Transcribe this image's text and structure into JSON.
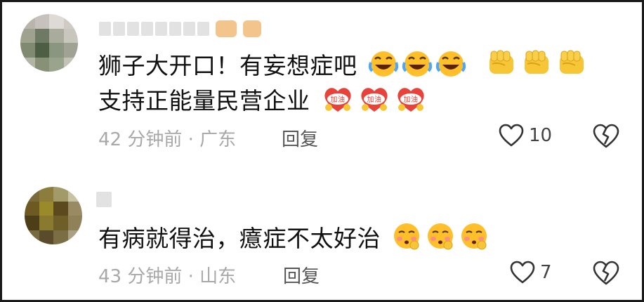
{
  "comments": [
    {
      "text_line1": "狮子大开口！有妄想症吧",
      "text_line2": "支持正能量民营企业",
      "time_location": "42 分钟前 · 广东",
      "reply_label": "回复",
      "like_count": "10",
      "emojis_line1": [
        "laughing-crying-emoji",
        "laughing-crying-emoji",
        "laughing-crying-emoji",
        "fist-emoji",
        "fist-emoji",
        "fist-emoji"
      ],
      "emojis_line2": [
        "jiayou-sticker",
        "jiayou-sticker",
        "jiayou-sticker"
      ],
      "sticker_label": "加油"
    },
    {
      "text_line1": "有病就得治，癔症不太好治",
      "time_location": "43 分钟前 · 山东",
      "reply_label": "回复",
      "like_count": "7",
      "emojis_line1": [
        "blushing-emoji",
        "blushing-emoji",
        "blushing-emoji"
      ]
    }
  ],
  "colors": {
    "text": "#111111",
    "meta": "#a8a8a8",
    "emoji_yellow": "#ffbf2a",
    "fist_yellow": "#f7c637",
    "sticker_red": "#e8433b"
  }
}
